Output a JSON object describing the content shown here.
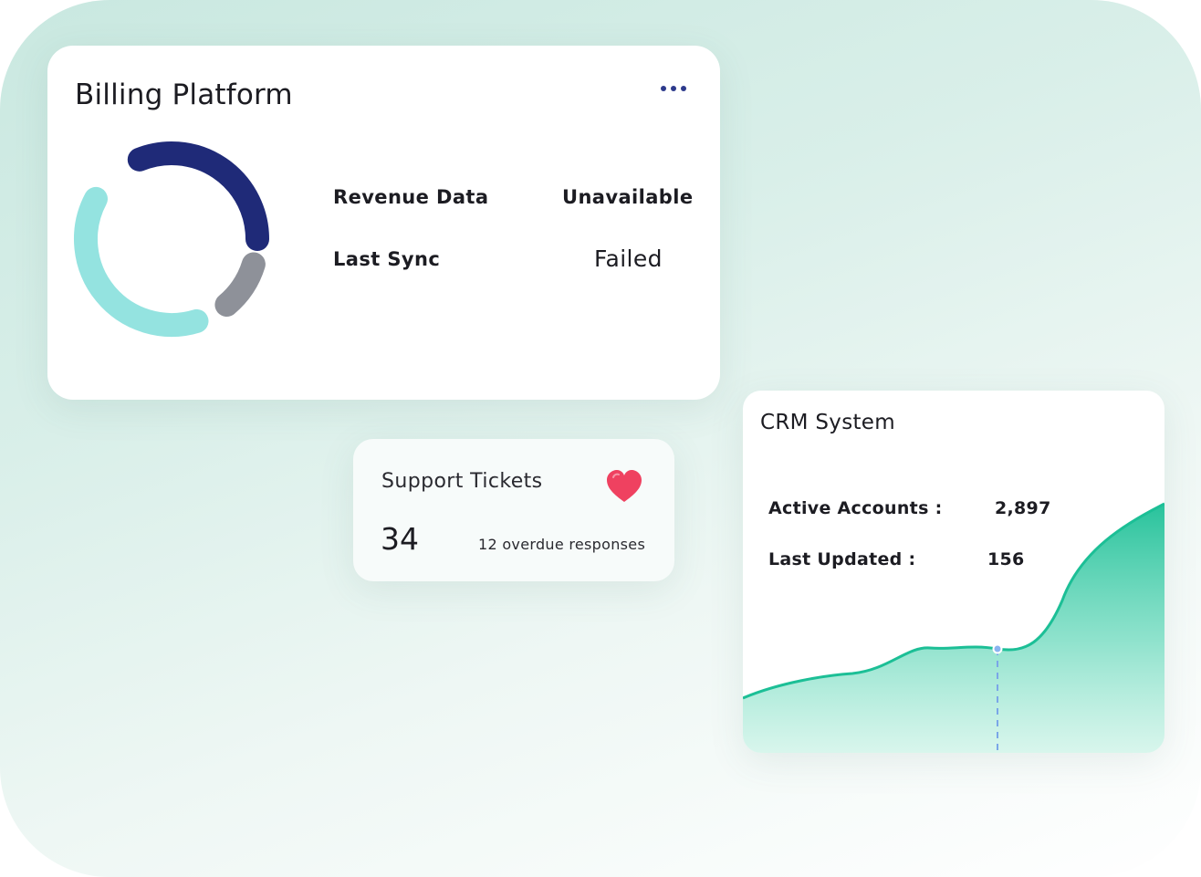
{
  "billing": {
    "title": "Billing Platform",
    "rows": [
      {
        "label": "Revenue Data",
        "value": "Unavailable"
      },
      {
        "label": "Last Sync",
        "value": "Failed"
      }
    ],
    "donut_segments": [
      {
        "name": "navy",
        "color": "#1f2a78"
      },
      {
        "name": "gray",
        "color": "#8e9199"
      },
      {
        "name": "aqua",
        "color": "#94e3e0"
      }
    ],
    "menu_icon": "more-horizontal-icon"
  },
  "support": {
    "title": "Support Tickets",
    "count": "34",
    "overdue": "12 overdue responses",
    "icon": "heart-icon",
    "icon_color": "#ef4160"
  },
  "crm": {
    "title": "CRM System",
    "rows": [
      {
        "label": "Active Accounts :",
        "value": "2,897"
      },
      {
        "label": "Last Updated :",
        "value": "156"
      }
    ],
    "accent": "#1cbf96"
  }
}
